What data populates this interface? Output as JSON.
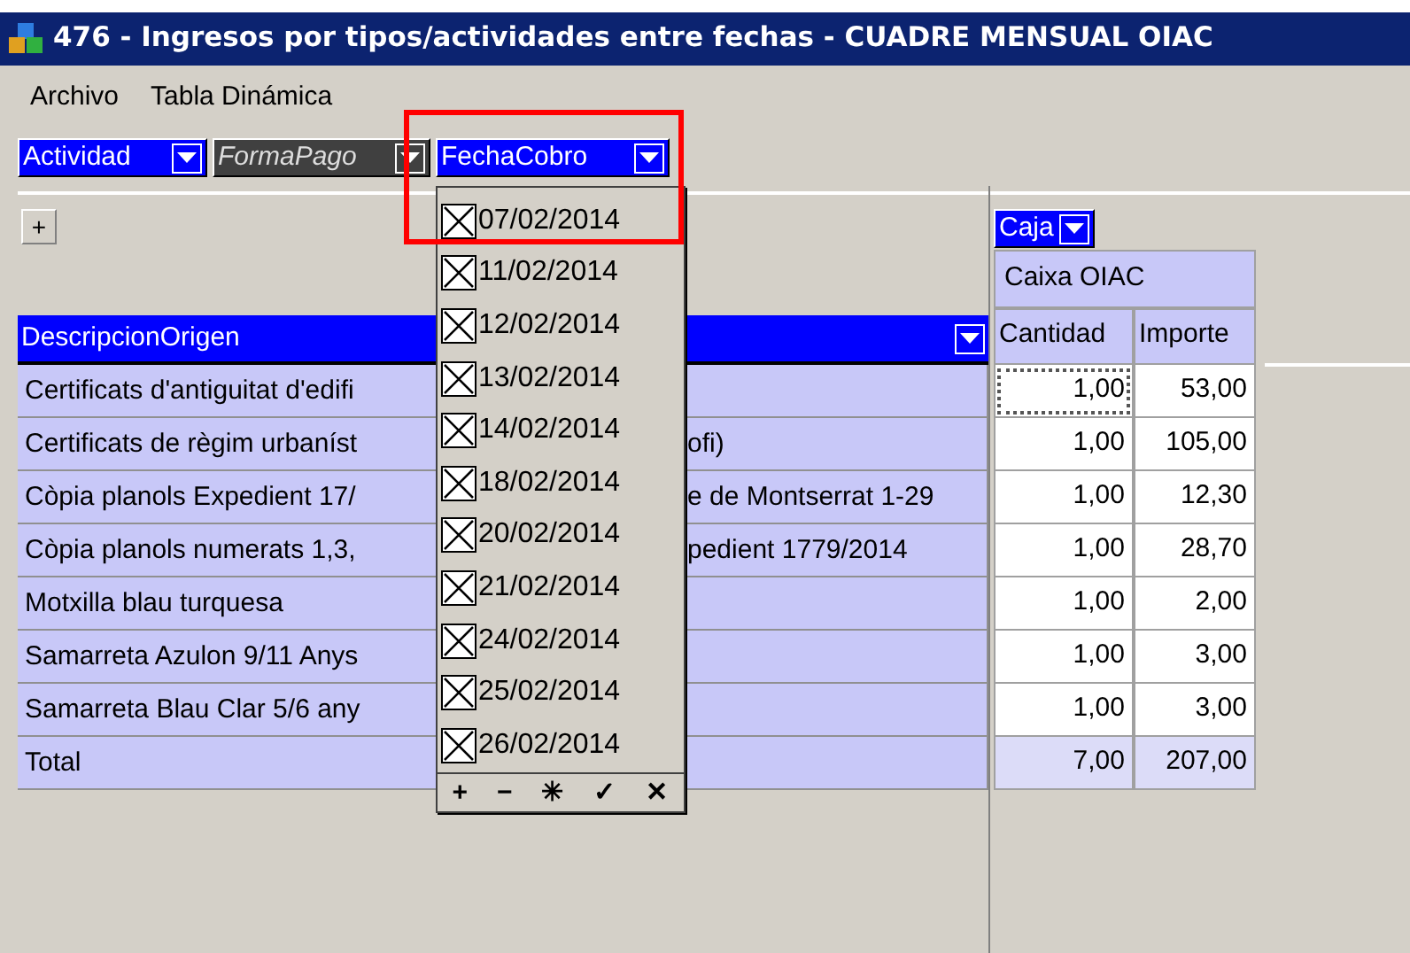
{
  "window": {
    "title": "476 - Ingresos por tipos/actividades entre fechas - CUADRE MENSUAL OIAC"
  },
  "menu": [
    "Archivo",
    "Tabla Dinámica"
  ],
  "page_fields": [
    {
      "label": "Actividad",
      "dimmed": false
    },
    {
      "label": "FormaPago",
      "dimmed": true
    },
    {
      "label": "FechaCobro",
      "dimmed": false
    }
  ],
  "expand_button": "+",
  "column_field": "Caja",
  "column_item": "Caixa OIAC",
  "row_field": "DescripcionOrigen",
  "measures": [
    "Cantidad",
    "Importe"
  ],
  "rows": [
    {
      "description": "Certificats d'antiguitat d'edifi",
      "description_after": "",
      "cantidad": "1,00",
      "importe": "53,00",
      "focused": true
    },
    {
      "description": "Certificats de règim urbaníst",
      "description_after": "ofi)",
      "cantidad": "1,00",
      "importe": "105,00",
      "focused": false
    },
    {
      "description": "Còpia planols Expedient 17/",
      "description_after": "e de Montserrat 1-29",
      "cantidad": "1,00",
      "importe": "12,30",
      "focused": false
    },
    {
      "description": "Còpia planols numerats 1,3,",
      "description_after": "pedient 1779/2014",
      "cantidad": "1,00",
      "importe": "28,70",
      "focused": false
    },
    {
      "description": "Motxilla blau turquesa",
      "description_after": "",
      "cantidad": "1,00",
      "importe": "2,00",
      "focused": false
    },
    {
      "description": "Samarreta Azulon 9/11 Anys",
      "description_after": "",
      "cantidad": "1,00",
      "importe": "3,00",
      "focused": false
    },
    {
      "description": "Samarreta Blau Clar 5/6 any",
      "description_after": "",
      "cantidad": "1,00",
      "importe": "3,00",
      "focused": false
    }
  ],
  "total": {
    "description": "Total",
    "cantidad": "7,00",
    "importe": "207,00"
  },
  "dropdown": {
    "items": [
      {
        "label": "07/02/2014",
        "checked": true
      },
      {
        "label": "11/02/2014",
        "checked": true
      },
      {
        "label": "12/02/2014",
        "checked": true
      },
      {
        "label": "13/02/2014",
        "checked": true
      },
      {
        "label": "14/02/2014",
        "checked": true
      },
      {
        "label": "18/02/2014",
        "checked": true
      },
      {
        "label": "20/02/2014",
        "checked": true
      },
      {
        "label": "21/02/2014",
        "checked": true
      },
      {
        "label": "24/02/2014",
        "checked": true
      },
      {
        "label": "25/02/2014",
        "checked": true
      },
      {
        "label": "26/02/2014",
        "checked": true
      }
    ],
    "tools": [
      "+",
      "−",
      "✳",
      "✓",
      "✕"
    ]
  }
}
